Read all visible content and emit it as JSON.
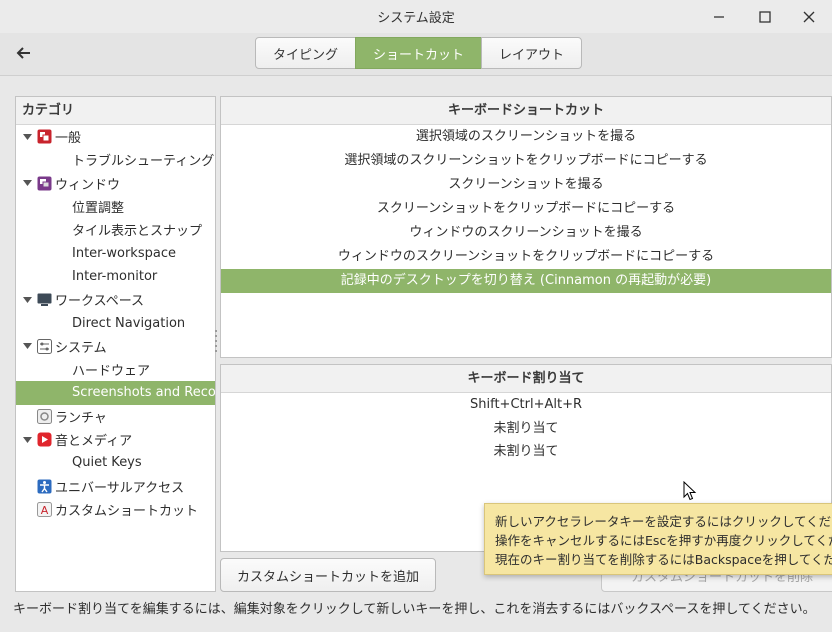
{
  "window": {
    "title": "システム設定"
  },
  "toolbar": {
    "tabs": [
      "タイピング",
      "ショートカット",
      "レイアウト"
    ],
    "active_tab": "ショートカット"
  },
  "sidebar": {
    "header": "カテゴリ",
    "items": [
      {
        "label": "一般",
        "level": 0,
        "icon": "general-icon"
      },
      {
        "label": "トラブルシューティング",
        "level": 1
      },
      {
        "label": "ウィンドウ",
        "level": 0,
        "icon": "windows-icon"
      },
      {
        "label": "位置調整",
        "level": 1
      },
      {
        "label": "タイル表示とスナップ",
        "level": 1
      },
      {
        "label": "Inter-workspace",
        "level": 1
      },
      {
        "label": "Inter-monitor",
        "level": 1
      },
      {
        "label": "ワークスペース",
        "level": 0,
        "icon": "workspace-icon"
      },
      {
        "label": "Direct Navigation",
        "level": 1
      },
      {
        "label": "システム",
        "level": 0,
        "icon": "system-icon"
      },
      {
        "label": "ハードウェア",
        "level": 1
      },
      {
        "label": "Screenshots and Recording",
        "level": 1,
        "selected": true
      },
      {
        "label": "ランチャ",
        "level": 0,
        "icon": "launcher-icon"
      },
      {
        "label": "音とメディア",
        "level": 0,
        "icon": "media-icon"
      },
      {
        "label": "Quiet Keys",
        "level": 1
      },
      {
        "label": "ユニバーサルアクセス",
        "level": 0,
        "icon": "accessibility-icon"
      },
      {
        "label": "カスタムショートカット",
        "level": 0,
        "icon": "custom-shortcut-icon"
      }
    ]
  },
  "shortcuts": {
    "header": "キーボードショートカット",
    "items": [
      "選択領域のスクリーンショットを撮る",
      "選択領域のスクリーンショットをクリップボードにコピーする",
      "スクリーンショットを撮る",
      "スクリーンショットをクリップボードにコピーする",
      "ウィンドウのスクリーンショットを撮る",
      "ウィンドウのスクリーンショットをクリップボードにコピーする",
      "記録中のデスクトップを切り替え (Cinnamon の再起動が必要)"
    ],
    "selected_index": 6
  },
  "bindings": {
    "header": "キーボード割り当て",
    "items": [
      "Shift+Ctrl+Alt+R",
      "未割り当て",
      "未割り当て"
    ]
  },
  "buttons": {
    "add_custom": "カスタムショートカットを追加",
    "remove_custom": "カスタムショートカットを削除"
  },
  "tooltip": {
    "lines": [
      "新しいアクセラレータキーを設定するにはクリックしてください。",
      "操作をキャンセルするにはEscを押すか再度クリックしてください。",
      "現在のキー割り当てを削除するにはBackspaceを押してください。"
    ]
  },
  "status": {
    "text": "キーボード割り当てを編集するには、編集対象をクリックして新しいキーを押し、これを消去するにはバックスペースを押してください。"
  },
  "colors": {
    "accent": "#8fb56a",
    "tooltip_bg": "#f6e6a2"
  }
}
